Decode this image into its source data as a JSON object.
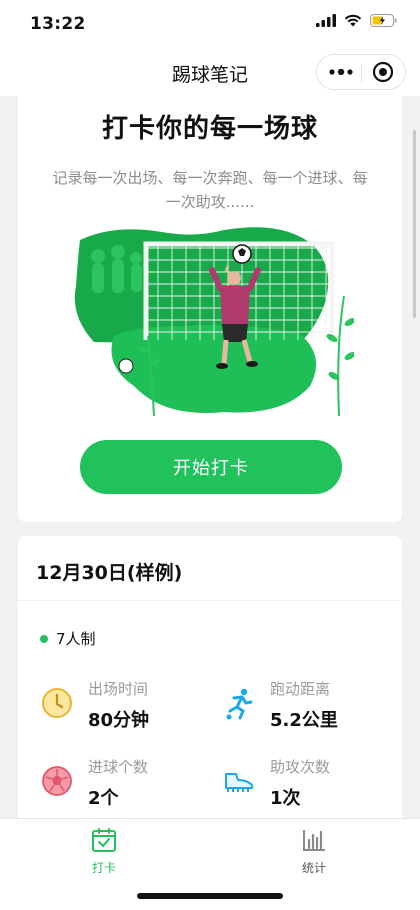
{
  "status": {
    "time": "13:22"
  },
  "nav": {
    "title": "踢球笔记"
  },
  "hero": {
    "title": "打卡你的每一场球",
    "desc": "记录每一次出场、每一次奔跑、每一个进球、每一次助攻......",
    "start_label": "开始打卡"
  },
  "match": {
    "date": "12月30日(样例)",
    "format": "7人制",
    "stats": [
      {
        "label": "出场时间",
        "value": "80分钟",
        "icon": "clock-icon"
      },
      {
        "label": "跑动距离",
        "value": "5.2公里",
        "icon": "runner-icon"
      },
      {
        "label": "进球个数",
        "value": "2个",
        "icon": "football-icon"
      },
      {
        "label": "助攻次数",
        "value": "1次",
        "icon": "boot-icon"
      }
    ]
  },
  "tabs": [
    {
      "label": "打卡",
      "icon": "calendar-check-icon",
      "active": true
    },
    {
      "label": "统计",
      "icon": "bar-chart-icon",
      "active": false
    }
  ],
  "colors": {
    "accent": "#21c15b",
    "muted": "#9a9a9a",
    "runner": "#1aa8e8",
    "clock": "#f0c330",
    "ball": "#ef6b7b"
  }
}
